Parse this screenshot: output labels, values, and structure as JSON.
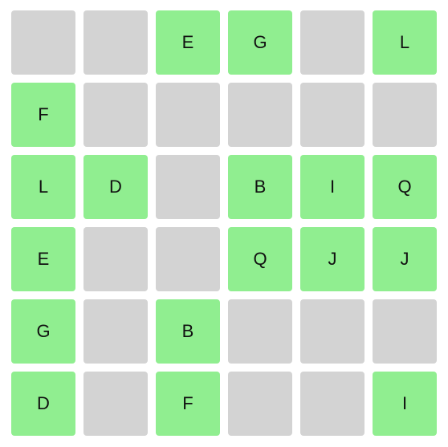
{
  "colors": {
    "filled": "#90ee90",
    "empty": "#d3d3d3",
    "text": "#111111"
  },
  "grid": [
    [
      "",
      "",
      "E",
      "G",
      "",
      "L"
    ],
    [
      "F",
      "",
      "",
      "",
      "",
      ""
    ],
    [
      "L",
      "D",
      "",
      "B",
      "I",
      "Q"
    ],
    [
      "E",
      "",
      "",
      "Q",
      "J",
      "J"
    ],
    [
      "G",
      "",
      "B",
      "",
      "",
      ""
    ],
    [
      "D",
      "",
      "F",
      "",
      "",
      "I"
    ]
  ]
}
